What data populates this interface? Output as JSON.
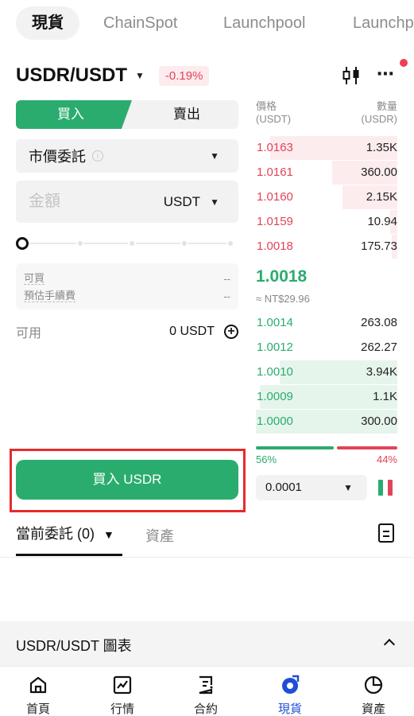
{
  "top_tabs": [
    "現貨",
    "ChainSpot",
    "Launchpool",
    "Launchpad"
  ],
  "pair": {
    "name": "USDR/USDT",
    "change": "-0.19%"
  },
  "trade": {
    "buy_label": "買入",
    "sell_label": "賣出",
    "order_type": "市價委託",
    "amount_placeholder": "金額",
    "amount_unit": "USDT",
    "buyable_label": "可買",
    "buyable_value": "--",
    "fee_label": "預估手續費",
    "fee_value": "--",
    "available_label": "可用",
    "available_value": "0 USDT",
    "submit_label": "買入 USDR",
    "slider_percent": 0
  },
  "orderbook": {
    "price_header": "價格",
    "price_unit": "(USDT)",
    "qty_header": "數量",
    "qty_unit": "(USDR)",
    "asks": [
      {
        "price": "1.0163",
        "qty": "1.35K",
        "depth": 0.9
      },
      {
        "price": "1.0161",
        "qty": "360.00",
        "depth": 0.46
      },
      {
        "price": "1.0160",
        "qty": "2.15K",
        "depth": 0.39
      },
      {
        "price": "1.0159",
        "qty": "10.94",
        "depth": 0.05
      },
      {
        "price": "1.0018",
        "qty": "175.73",
        "depth": 0.04
      }
    ],
    "last_price": "1.0018",
    "fiat_price": "≈ NT$29.96",
    "bids": [
      {
        "price": "1.0014",
        "qty": "263.08",
        "depth": 0
      },
      {
        "price": "1.0012",
        "qty": "262.27",
        "depth": 0
      },
      {
        "price": "1.0010",
        "qty": "3.94K",
        "depth": 0.83
      },
      {
        "price": "1.0009",
        "qty": "1.1K",
        "depth": 0.97
      },
      {
        "price": "1.0000",
        "qty": "300.00",
        "depth": 1.0
      }
    ],
    "buy_ratio": "56%",
    "sell_ratio": "44%",
    "buy_fraction": 0.56,
    "precision": "0.0001"
  },
  "orders": {
    "open_orders_tab": "當前委託 (0)",
    "assets_tab": "資產"
  },
  "chart_section": {
    "title": "USDR/USDT 圖表"
  },
  "bottom_nav": [
    {
      "label": "首頁",
      "icon": "home-icon"
    },
    {
      "label": "行情",
      "icon": "market-icon"
    },
    {
      "label": "合約",
      "icon": "contract-icon"
    },
    {
      "label": "現貨",
      "icon": "spot-icon",
      "active": true
    },
    {
      "label": "資產",
      "icon": "assets-icon"
    }
  ],
  "colors": {
    "buy": "#2aac6e",
    "sell": "#e0445a",
    "active_nav": "#1f4fd8",
    "highlight_box": "#e52b2b"
  }
}
